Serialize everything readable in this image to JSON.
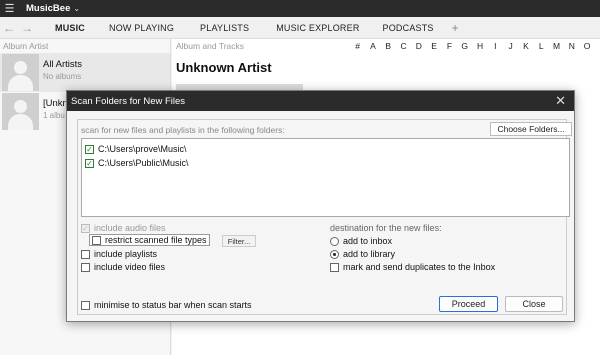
{
  "app": {
    "name": "MusicBee"
  },
  "nav": {
    "back": "←",
    "forward": "→"
  },
  "tabs": [
    {
      "label": "MUSIC",
      "active": true
    },
    {
      "label": "NOW PLAYING"
    },
    {
      "label": "PLAYLISTS"
    },
    {
      "label": "MUSIC EXPLORER"
    },
    {
      "label": "PODCASTS"
    }
  ],
  "tab_add": "+",
  "left_pane": {
    "header": "Album Artist",
    "items": [
      {
        "name": "All Artists",
        "sub": "No albums"
      },
      {
        "name": "[Unkn",
        "sub": "1 albu"
      }
    ]
  },
  "main": {
    "header": "Album and Tracks",
    "alphabet": [
      "#",
      "A",
      "B",
      "C",
      "D",
      "E",
      "F",
      "G",
      "H",
      "I",
      "J",
      "K",
      "L",
      "M",
      "N",
      "O"
    ],
    "title": "Unknown Artist"
  },
  "dialog": {
    "title": "Scan Folders for New Files",
    "close": "✕",
    "scan_label": "scan for new files and playlists in the following folders:",
    "choose_button": "Choose Folders...",
    "folders": [
      {
        "path": "C:\\Users\\prove\\Music\\",
        "checked": true
      },
      {
        "path": "C:\\Users\\Public\\Music\\",
        "checked": true
      }
    ],
    "options": {
      "include_audio": "include audio files",
      "restrict_types": "restrict scanned file types",
      "filter_button": "Filter...",
      "include_playlists": "include playlists",
      "include_video": "include video files"
    },
    "destination": {
      "label": "destination for the new files:",
      "inbox": "add to inbox",
      "library": "add to library",
      "duplicates": "mark and send duplicates to the Inbox",
      "selected": "library"
    },
    "minimise": "minimise to status bar when scan starts",
    "proceed_button": "Proceed",
    "close_button": "Close"
  },
  "colors": {
    "dark": "#2b2b2b",
    "accent": "#2b6ed4",
    "check": "#2e7d32"
  }
}
